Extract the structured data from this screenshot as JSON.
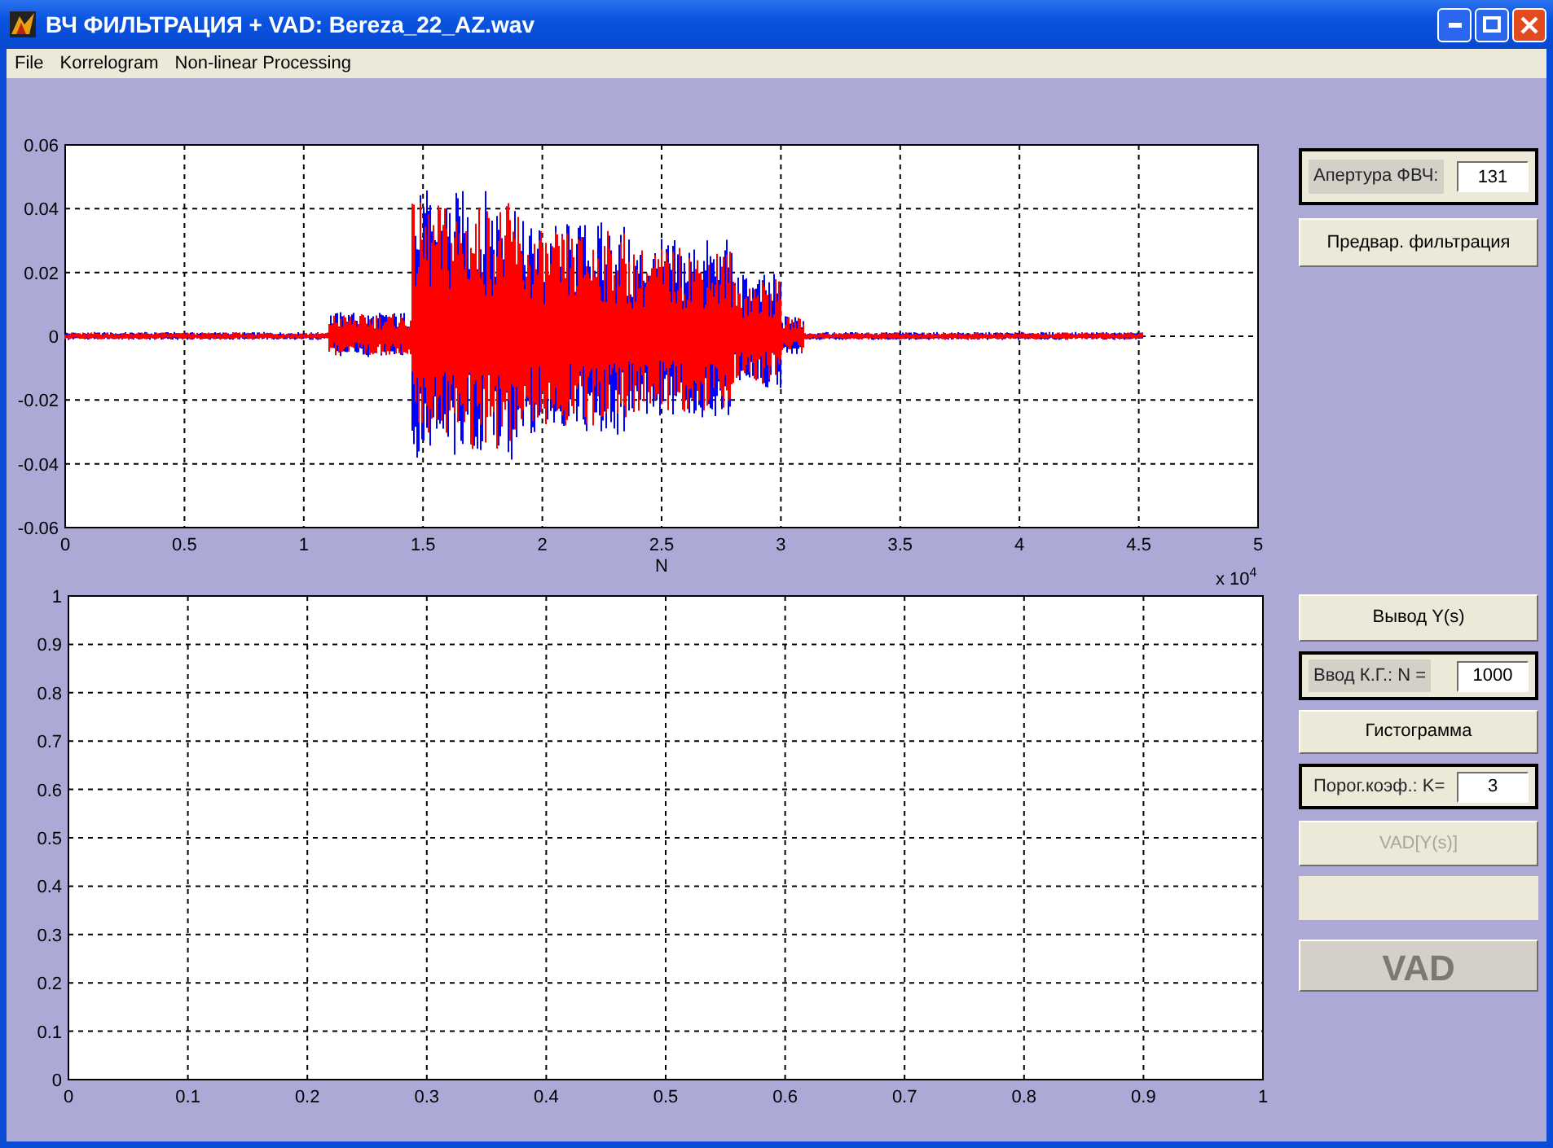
{
  "window": {
    "title": "ВЧ ФИЛЬТРАЦИЯ + VAD: Bereza_22_AZ.wav"
  },
  "menu": [
    "File",
    "Korrelogram",
    "Non-linear Processing"
  ],
  "signal_plot": {
    "yticks": [
      "0.06",
      "0.04",
      "0.02",
      "0",
      "-0.02",
      "-0.04",
      "-0.06"
    ],
    "xticks": [
      "0",
      "0.5",
      "1",
      "1.5",
      "2",
      "2.5",
      "3",
      "3.5",
      "4",
      "4.5",
      "5"
    ],
    "xlabel": "N",
    "x_multiplier": "x 10",
    "x_exponent": "4"
  },
  "histogram_plot": {
    "yticks": [
      "1",
      "0.9",
      "0.8",
      "0.7",
      "0.6",
      "0.5",
      "0.4",
      "0.3",
      "0.2",
      "0.1",
      "0"
    ],
    "xticks": [
      "0",
      "0.1",
      "0.2",
      "0.3",
      "0.4",
      "0.5",
      "0.6",
      "0.7",
      "0.8",
      "0.9",
      "1"
    ]
  },
  "controls": [
    {
      "kind": "field",
      "label": "Апертура ФВЧ:",
      "value": "131",
      "label_shaded": true
    },
    {
      "kind": "button",
      "label": "Предвар. фильтрация",
      "disabled": false
    },
    {
      "kind": "button",
      "label": "Вывод Y(s)",
      "disabled": false
    },
    {
      "kind": "field",
      "label": "Ввод  К.Г.:  N =",
      "value": "1000",
      "label_shaded": true
    },
    {
      "kind": "button",
      "label": "Гистограмма",
      "disabled": false
    },
    {
      "kind": "field",
      "label": "Порог.коэф.: K=",
      "value": "3",
      "label_shaded": false
    },
    {
      "kind": "button",
      "label": "VAD[Y(s)]",
      "disabled": true
    },
    {
      "kind": "blank"
    },
    {
      "kind": "big_button",
      "label": "VAD",
      "disabled": true
    }
  ]
}
